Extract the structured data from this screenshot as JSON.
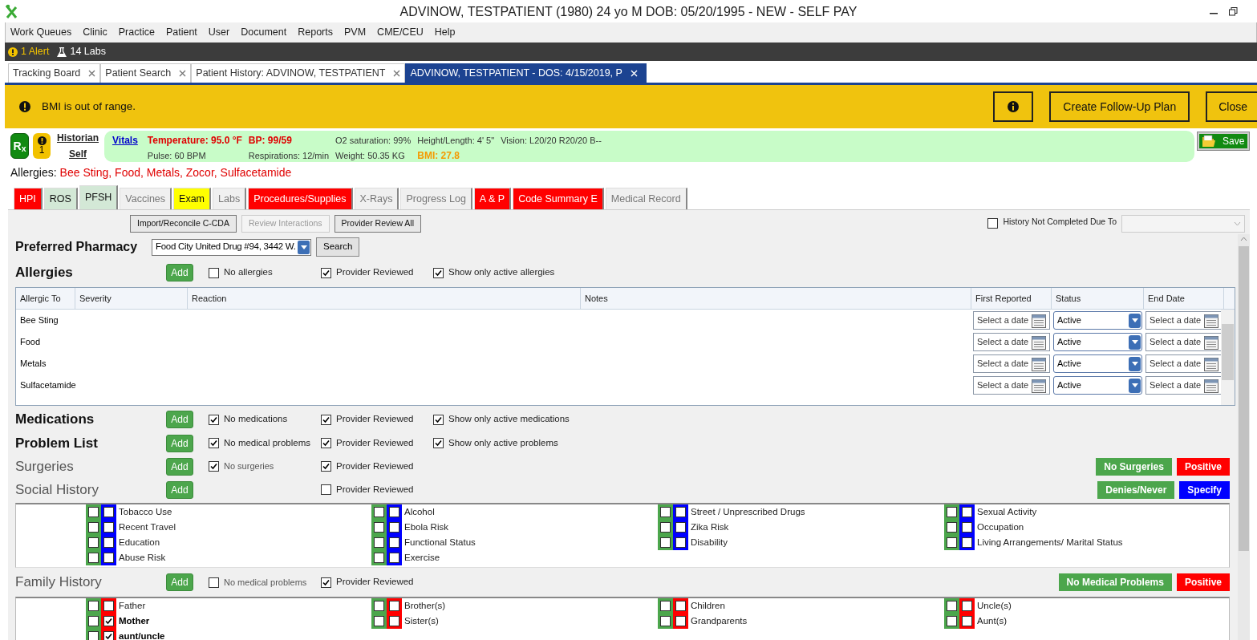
{
  "window": {
    "title": "ADVINOW, TESTPATIENT (1980) 24 yo M DOB: 05/20/1995 - NEW - SELF PAY"
  },
  "menu": [
    "Work Queues",
    "Clinic",
    "Practice",
    "Patient",
    "User",
    "Document",
    "Reports",
    "PVM",
    "CME/CEU",
    "Help"
  ],
  "notifications": [
    {
      "kind": "alert",
      "label": "1 Alert"
    },
    {
      "kind": "labs",
      "label": "14 Labs"
    }
  ],
  "tabs": [
    {
      "label": "Tracking Board",
      "selected": false
    },
    {
      "label": "Patient Search",
      "selected": false
    },
    {
      "label": "Patient History: ADVINOW, TESTPATIENT",
      "selected": false
    },
    {
      "label": "ADVINOW, TESTPATIENT - DOS: 4/15/2019, P",
      "selected": true
    }
  ],
  "banner": {
    "message": "BMI is out of range.",
    "buttons": [
      "Create Follow-Up Plan",
      "Close"
    ]
  },
  "patient": {
    "rx": "R$_{x}$",
    "alert_count": "1",
    "historian_label": "Historian",
    "historian": "Self"
  },
  "vitals": {
    "link": "Vitals",
    "columns": [
      [
        {
          "text": "Temperature: 95.0 °F",
          "kind": "critical"
        },
        {
          "text": "Pulse: 60 BPM",
          "kind": "normal"
        }
      ],
      [
        {
          "text": "BP: 99/59",
          "kind": "critical"
        },
        {
          "text": "Respirations: 12/min",
          "kind": "normal"
        }
      ],
      [
        {
          "text": "O2 saturation: 99%",
          "kind": "normal"
        },
        {
          "text": "Weight: 50.35 KG",
          "kind": "normal"
        }
      ],
      [
        {
          "text": "Height/Length: 4' 5\"",
          "kind": "normal"
        },
        {
          "text": "BMI: 27.8",
          "kind": "warning"
        }
      ],
      [
        {
          "text": "Vision: L20/20 R20/20 B--",
          "kind": "normal"
        }
      ]
    ]
  },
  "save": "Save",
  "allergy_summary": {
    "label": "Allergies:",
    "items": "Bee Sting, Food, Metals, Zocor, Sulfacetamide"
  },
  "section_tabs": [
    {
      "label": "HPI",
      "color": "#ff0000",
      "selected": false
    },
    {
      "label": "ROS",
      "color": "#d3e8d6",
      "selected": false
    },
    {
      "label": "PFSH",
      "color": "#d3e8d6",
      "selected": true
    },
    {
      "label": "Vaccines",
      "color": "#f0f0f0",
      "selected": false
    },
    {
      "label": "Exam",
      "color": "#ffff00",
      "selected": false
    },
    {
      "label": "Labs",
      "color": "#f0f0f0",
      "selected": false
    },
    {
      "label": "Procedures/Supplies",
      "color": "#ff0000",
      "selected": false
    },
    {
      "label": "X-Rays",
      "color": "#f0f0f0",
      "selected": false
    },
    {
      "label": "Progress Log",
      "color": "#f0f0f0",
      "selected": false
    },
    {
      "label": "A & P",
      "color": "#ff0000",
      "selected": false
    },
    {
      "label": "Code Summary E",
      "color": "#ff0000",
      "selected": false
    },
    {
      "label": "Medical Record",
      "color": "#f0f0f0",
      "selected": false
    }
  ],
  "toolbar": {
    "buttons": [
      {
        "label": "Import/Reconcile C-CDA",
        "disabled": false
      },
      {
        "label": "Review Interactions",
        "disabled": true
      },
      {
        "label": "Provider Review All",
        "disabled": false
      }
    ],
    "history_not_completed": {
      "label": "History Not Completed Due To",
      "checked": false
    }
  },
  "pharmacy": {
    "label": "Preferred Pharmacy",
    "value": "Food City United Drug #94, 3442 W.",
    "button": "Search"
  },
  "allergies": {
    "title": "Allergies",
    "kind": "primary",
    "add": "Add",
    "none_option": {
      "label": "No allergies",
      "checked": false
    },
    "reviewed": {
      "label": "Provider Reviewed",
      "checked": true
    },
    "active_only": {
      "label": "Show only active allergies",
      "checked": true
    },
    "columns": [
      "Allergic To",
      "Severity",
      "Reaction",
      "Notes",
      "First Reported",
      "Status",
      "End Date"
    ],
    "rows": [
      {
        "allergic_to": "Bee Sting",
        "first_reported": "Select a date",
        "status": "Active",
        "end_date": "Select a date"
      },
      {
        "allergic_to": "Food",
        "first_reported": "Select a date",
        "status": "Active",
        "end_date": "Select a date"
      },
      {
        "allergic_to": "Metals",
        "first_reported": "Select a date",
        "status": "Active",
        "end_date": "Select a date"
      },
      {
        "allergic_to": "Sulfacetamide",
        "first_reported": "Select a date",
        "status": "Active",
        "end_date": "Select a date"
      }
    ]
  },
  "sections": [
    {
      "title": "Medications",
      "kind": "primary",
      "add": "Add",
      "none_option": {
        "label": "No medications",
        "checked": true
      },
      "reviewed": {
        "label": "Provider Reviewed",
        "checked": true
      },
      "active_only": {
        "label": "Show only active medications",
        "checked": true
      }
    },
    {
      "title": "Problem List",
      "kind": "primary",
      "add": "Add",
      "none_option": {
        "label": "No medical problems",
        "checked": true
      },
      "reviewed": {
        "label": "Provider Reviewed",
        "checked": true
      },
      "active_only": {
        "label": "Show only active problems",
        "checked": true
      }
    },
    {
      "title": "Surgeries",
      "kind": "secondary",
      "add": "Add",
      "none_option": {
        "label": "No surgeries",
        "checked": true
      },
      "reviewed": {
        "label": "Provider Reviewed",
        "checked": true
      },
      "actions": [
        {
          "label": "No Surgeries",
          "kind": "negative"
        },
        {
          "label": "Positive",
          "kind": "positive"
        }
      ]
    },
    {
      "title": "Social History",
      "kind": "secondary",
      "add": "Add",
      "reviewed": {
        "label": "Provider Reviewed",
        "checked": false
      },
      "actions": [
        {
          "label": "Denies/Never",
          "kind": "negative"
        },
        {
          "label": "Specify",
          "kind": "specify"
        }
      ],
      "grid": {
        "kind": "social",
        "columns": [
          [
            {
              "label": "Tobacco Use",
              "negative": false,
              "positive": false
            },
            {
              "label": "Recent Travel",
              "negative": false,
              "positive": false
            },
            {
              "label": "Education",
              "negative": false,
              "positive": false
            },
            {
              "label": "Abuse Risk",
              "negative": false,
              "positive": false
            }
          ],
          [
            {
              "label": "Alcohol",
              "negative": false,
              "positive": false
            },
            {
              "label": "Ebola Risk",
              "negative": false,
              "positive": false
            },
            {
              "label": "Functional Status",
              "negative": false,
              "positive": false
            },
            {
              "label": "Exercise",
              "negative": false,
              "positive": false
            }
          ],
          [
            {
              "label": "Street / Unprescribed Drugs",
              "negative": false,
              "positive": false
            },
            {
              "label": "Zika Risk",
              "negative": false,
              "positive": false
            },
            {
              "label": "Disability",
              "negative": false,
              "positive": false
            }
          ],
          [
            {
              "label": "Sexual Activity",
              "negative": false,
              "positive": false
            },
            {
              "label": "Occupation",
              "negative": false,
              "positive": false
            },
            {
              "label": "Living Arrangements/ Marital Status",
              "negative": false,
              "positive": false
            }
          ]
        ]
      }
    },
    {
      "title": "Family History",
      "kind": "secondary",
      "add": "Add",
      "none_option": {
        "label": "No medical problems",
        "checked": false
      },
      "reviewed": {
        "label": "Provider Reviewed",
        "checked": true
      },
      "actions": [
        {
          "label": "No Medical Problems",
          "kind": "negative"
        },
        {
          "label": "Positive",
          "kind": "positive"
        }
      ],
      "grid": {
        "kind": "family",
        "columns": [
          [
            {
              "label": "Father",
              "negative": false,
              "positive": false
            },
            {
              "label": "Mother",
              "negative": false,
              "positive": true
            },
            {
              "label": "aunt/uncle",
              "negative": false,
              "positive": true
            }
          ],
          [
            {
              "label": "Brother(s)",
              "negative": false,
              "positive": false
            },
            {
              "label": "Sister(s)",
              "negative": false,
              "positive": false
            }
          ],
          [
            {
              "label": "Children",
              "negative": false,
              "positive": false
            },
            {
              "label": "Grandparents",
              "negative": false,
              "positive": false
            }
          ],
          [
            {
              "label": "Uncle(s)",
              "negative": false,
              "positive": false
            },
            {
              "label": "Aunt(s)",
              "negative": false,
              "positive": false
            }
          ]
        ]
      }
    }
  ]
}
